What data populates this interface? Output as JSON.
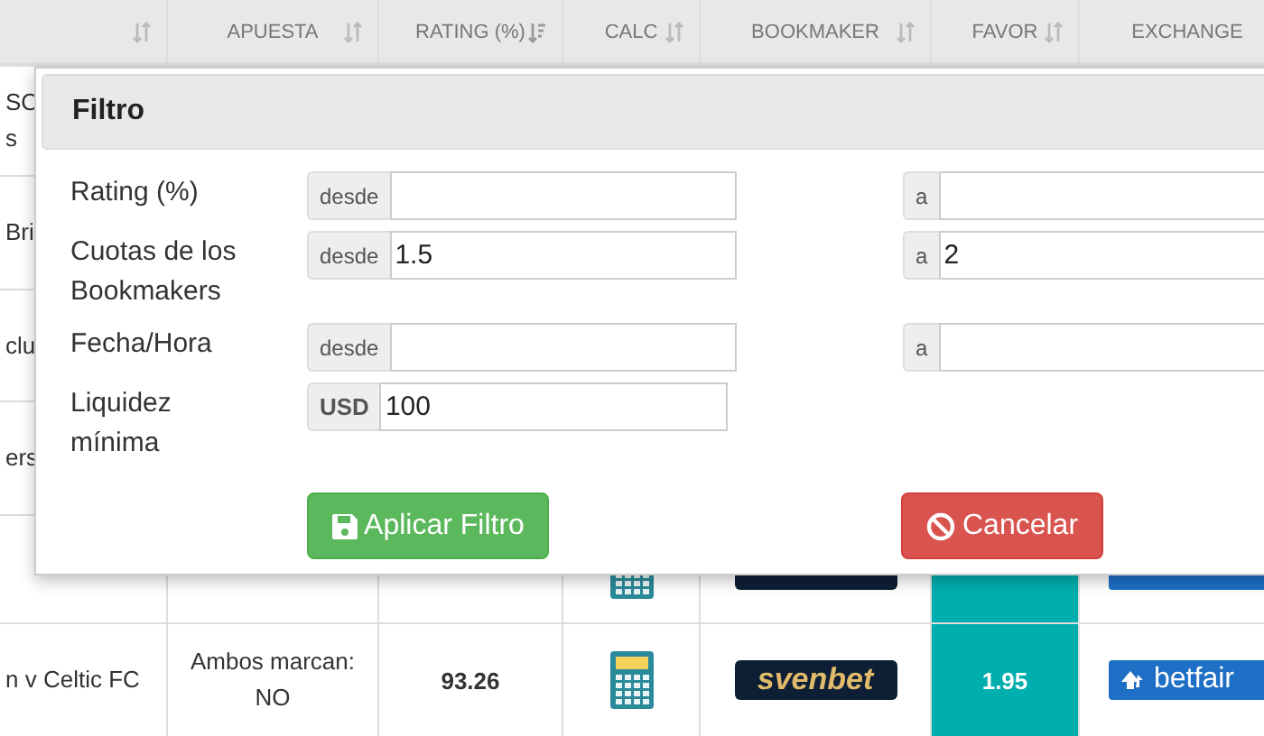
{
  "table": {
    "columns": [
      {
        "kind": "sortable"
      },
      {
        "label": "APUESTA",
        "kind": "sortable"
      },
      {
        "label": "RATING (%)",
        "kind": "sorted"
      },
      {
        "label": "CALC",
        "kind": "sortable"
      },
      {
        "label": "BOOKMAKER",
        "kind": "sortable"
      },
      {
        "label": "FAVOR",
        "kind": "sortable"
      },
      {
        "label": "EXCHANGE",
        "kind": "plain"
      }
    ],
    "rows": [
      {
        "kind": "covered",
        "event": [
          "SO",
          "s"
        ]
      },
      {
        "kind": "covered",
        "event": [
          "Bri"
        ]
      },
      {
        "kind": "covered",
        "event": [
          "clu"
        ]
      },
      {
        "kind": "covered",
        "event": [
          "ers"
        ]
      },
      {
        "kind": "partial"
      },
      {
        "kind": "full",
        "event": [
          "n v Celtic FC"
        ],
        "bet": [
          "Ambos marcan:",
          "NO"
        ],
        "rating": "93.26",
        "bookmaker": "svenbet",
        "favor": "1.95",
        "exchange": "betfair"
      }
    ]
  },
  "modal": {
    "title": "Filtro",
    "filters": [
      {
        "kind": "range",
        "label": [
          "Rating (%)"
        ],
        "from_addon": "desde",
        "to_addon": "a"
      },
      {
        "kind": "range",
        "label": [
          "Cuotas de los",
          "Bookmakers"
        ],
        "from_addon": "desde",
        "from": "1.5",
        "to_addon": "a",
        "to": "2"
      },
      {
        "kind": "range",
        "label": [
          "Fecha/Hora"
        ],
        "from_addon": "desde",
        "to_addon": "a"
      },
      {
        "kind": "amount",
        "label": [
          "Liquidez",
          "mínima"
        ],
        "addon": "USD",
        "value": "100"
      }
    ],
    "buttons": [
      {
        "kind": "apply",
        "label": "Aplicar Filtro"
      },
      {
        "kind": "cancel",
        "label": "Cancelar"
      }
    ]
  }
}
